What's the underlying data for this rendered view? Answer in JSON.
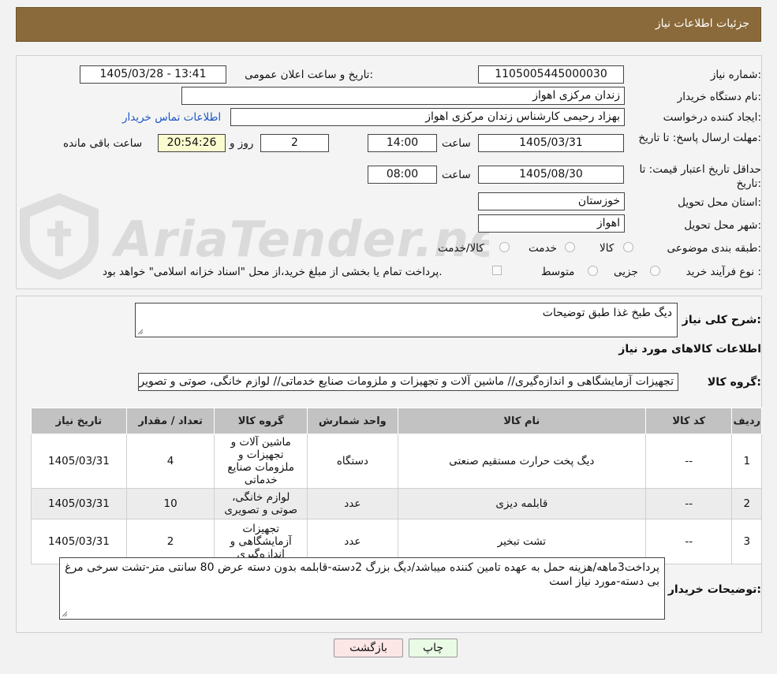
{
  "header": {
    "title": "جزئیات اطلاعات نیاز"
  },
  "watermark": {
    "text": "AriaTender.neT"
  },
  "form": {
    "need_number_label": "شماره نیاز:",
    "need_number": "1105005445000030",
    "announce_label": "تاریخ و ساعت اعلان عمومی:",
    "announce_value": "1405/03/28 - 13:41",
    "buyer_org_label": "نام دستگاه خریدار:",
    "buyer_org": "زندان مرکزی اهواز",
    "creator_label": "ایجاد کننده درخواست:",
    "creator": "بهزاد رحیمی کارشناس زندان مرکزی اهواز",
    "contact_link": "اطلاعات تماس خریدار",
    "reply_deadline_label": "مهلت ارسال پاسخ: تا تاریخ:",
    "reply_date": "1405/03/31",
    "time_label": "ساعت",
    "reply_time": "14:00",
    "days_value": "2",
    "days_label": "روز و",
    "remaining_time": "20:54:26",
    "remaining_label": "ساعت باقی مانده",
    "validity_label": "حداقل تاریخ اعتبار قیمت: تا تاریخ:",
    "validity_date": "1405/08/30",
    "validity_time": "08:00",
    "province_label": "استان محل تحویل:",
    "province": "خوزستان",
    "city_label": "شهر محل تحویل:",
    "city": "اهواز",
    "category_label": "طبقه بندی موضوعی:",
    "category_options": [
      "کالا",
      "خدمت",
      "کالا/خدمت"
    ],
    "process_label": "نوع فرآیند خرید :",
    "process_options": [
      "جزیی",
      "متوسط"
    ],
    "payment_note": "پرداخت تمام یا بخشی از مبلغ خرید،از محل \"اسناد خزانه اسلامی\" خواهد بود."
  },
  "details": {
    "summary_label": "شرح کلی نیاز:",
    "summary": "دیگ طبخ غذا طبق توضیحات",
    "goods_info_title": "اطلاعات کالاهای مورد نیاز",
    "goods_group_label": "گروه کالا:",
    "goods_group": "تجهیزات آزمایشگاهی و اندازه‌گیری// ماشین آلات و تجهیزات و ملزومات صنایع خدماتی// لوازم خانگی، صوتی و تصویری",
    "table": {
      "headers": [
        "ردیف",
        "کد کالا",
        "نام کالا",
        "واحد شمارش",
        "گروه کالا",
        "تعداد / مقدار",
        "تاریخ نیاز"
      ],
      "rows": [
        {
          "row": "1",
          "code": "--",
          "name": "دیگ پخت حرارت مستقیم صنعتی",
          "unit": "دستگاه",
          "group": "ماشین آلات و تجهیزات و ملزومات صنایع خدماتی",
          "qty": "4",
          "date": "1405/03/31"
        },
        {
          "row": "2",
          "code": "--",
          "name": "قابلمه دیزی",
          "unit": "عدد",
          "group": "لوازم خانگی، صوتی و تصویری",
          "qty": "10",
          "date": "1405/03/31"
        },
        {
          "row": "3",
          "code": "--",
          "name": "تشت تبخیر",
          "unit": "عدد",
          "group": "تجهیزات آزمایشگاهی و اندازه‌گیری",
          "qty": "2",
          "date": "1405/03/31"
        }
      ]
    },
    "buyer_notes_label": "توضیحات خریدار:",
    "buyer_notes": "پرداخت3ماهه/هزینه حمل به عهده تامین کننده میباشد/دیگ بزرگ 2دسته-قابلمه بدون دسته عرض 80 سانتی متر-تشت سرخی مرغ بی دسته-مورد نیاز است"
  },
  "buttons": {
    "print": "چاپ",
    "back": "بازگشت"
  },
  "colors": {
    "header": "#8a6a3a",
    "link": "#1a55c7",
    "print_button": "#e9fbe4",
    "back_button": "#fde6e6"
  }
}
